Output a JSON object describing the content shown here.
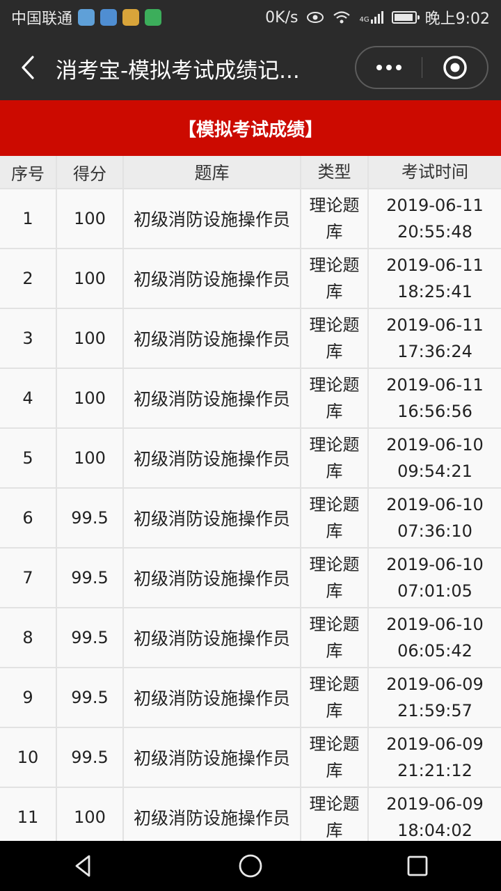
{
  "status_bar": {
    "carrier": "中国联通",
    "net_speed": "0K/s",
    "signal_label": "4G",
    "time": "晚上9:02",
    "app_icons": [
      "browser-icon",
      "browser-icon",
      "game-icon",
      "video-icon"
    ]
  },
  "nav": {
    "title": "消考宝-模拟考试成绩记...",
    "icons": {
      "back": "back-arrow-icon",
      "more": "more-icon",
      "close": "target-close-icon"
    }
  },
  "banner": {
    "title": "【模拟考试成绩】"
  },
  "table": {
    "headers": [
      "序号",
      "得分",
      "题库",
      "类型",
      "考试时间"
    ],
    "rows": [
      {
        "no": "1",
        "score": "100",
        "bank": "初级消防设施操作员",
        "type": "理论题库",
        "date": "2019-06-11",
        "time": "20:55:48"
      },
      {
        "no": "2",
        "score": "100",
        "bank": "初级消防设施操作员",
        "type": "理论题库",
        "date": "2019-06-11",
        "time": "18:25:41"
      },
      {
        "no": "3",
        "score": "100",
        "bank": "初级消防设施操作员",
        "type": "理论题库",
        "date": "2019-06-11",
        "time": "17:36:24"
      },
      {
        "no": "4",
        "score": "100",
        "bank": "初级消防设施操作员",
        "type": "理论题库",
        "date": "2019-06-11",
        "time": "16:56:56"
      },
      {
        "no": "5",
        "score": "100",
        "bank": "初级消防设施操作员",
        "type": "理论题库",
        "date": "2019-06-10",
        "time": "09:54:21"
      },
      {
        "no": "6",
        "score": "99.5",
        "bank": "初级消防设施操作员",
        "type": "理论题库",
        "date": "2019-06-10",
        "time": "07:36:10"
      },
      {
        "no": "7",
        "score": "99.5",
        "bank": "初级消防设施操作员",
        "type": "理论题库",
        "date": "2019-06-10",
        "time": "07:01:05"
      },
      {
        "no": "8",
        "score": "99.5",
        "bank": "初级消防设施操作员",
        "type": "理论题库",
        "date": "2019-06-10",
        "time": "06:05:42"
      },
      {
        "no": "9",
        "score": "99.5",
        "bank": "初级消防设施操作员",
        "type": "理论题库",
        "date": "2019-06-09",
        "time": "21:59:57"
      },
      {
        "no": "10",
        "score": "99.5",
        "bank": "初级消防设施操作员",
        "type": "理论题库",
        "date": "2019-06-09",
        "time": "21:21:12"
      },
      {
        "no": "11",
        "score": "100",
        "bank": "初级消防设施操作员",
        "type": "理论题库",
        "date": "2019-06-09",
        "time": "18:04:02"
      }
    ]
  },
  "bottom_nav": {
    "icons": [
      "nav-back-icon",
      "nav-home-icon",
      "nav-recent-icon"
    ]
  },
  "colors": {
    "banner": "#cc0a00",
    "header_bg": "#2b2b2b",
    "table_head": "#ececec"
  }
}
